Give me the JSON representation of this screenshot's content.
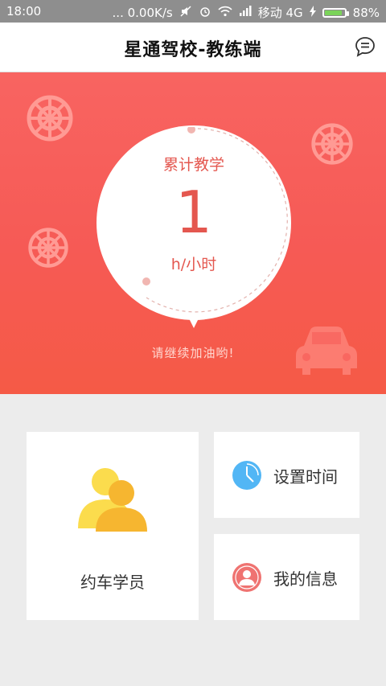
{
  "status_bar": {
    "time": "18:00",
    "speed": "... 0.00K/s",
    "network": "移动 4G",
    "battery": "88%",
    "battery_level": 0.88
  },
  "header": {
    "title": "星通驾校-教练端",
    "message_icon": "chat-bubble-icon"
  },
  "stats": {
    "label": "累计教学",
    "value": "1",
    "unit": "h/小时",
    "encouragement": "请继续加油哟!"
  },
  "menu": {
    "students": {
      "label": "约车学员",
      "icon": "users-icon",
      "color": "#f6c23a"
    },
    "set_time": {
      "label": "设置时间",
      "icon": "clock-icon",
      "color": "#3ea8f2"
    },
    "my_info": {
      "label": "我的信息",
      "icon": "profile-icon",
      "color": "#ef6f6c"
    }
  },
  "colors": {
    "accent": "#f65a55",
    "text_on_card": "#e4574f"
  }
}
